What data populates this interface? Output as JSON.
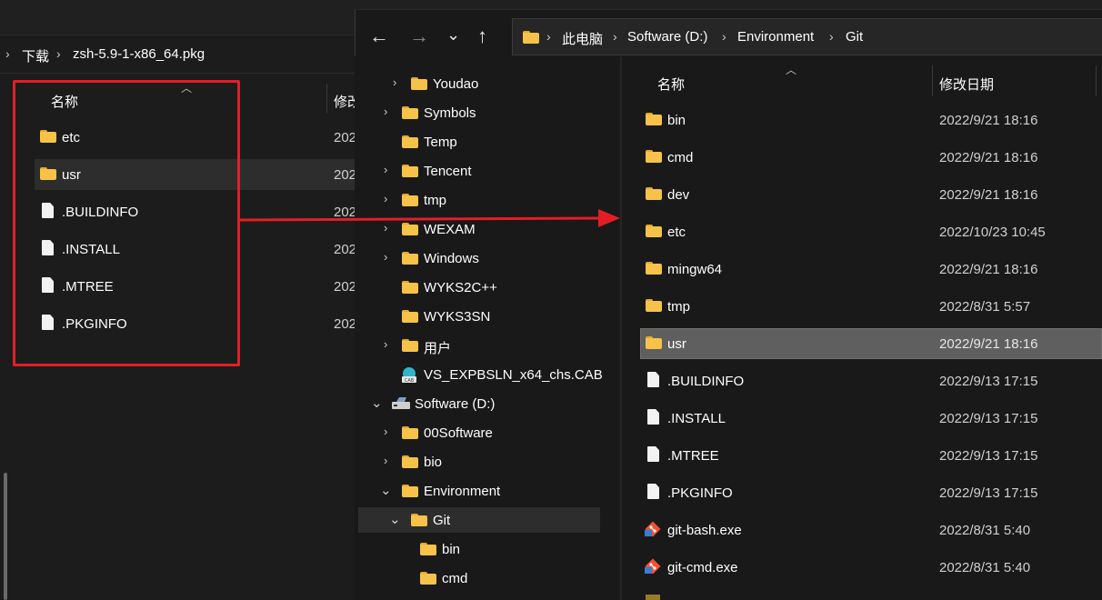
{
  "left_window": {
    "breadcrumb": [
      "下载",
      "zsh-5.9-1-x86_64.pkg"
    ],
    "columns": {
      "name": "名称",
      "modified_partial": "修改"
    },
    "items": [
      {
        "name": "etc",
        "type": "folder",
        "date_partial": "202"
      },
      {
        "name": "usr",
        "type": "folder",
        "date_partial": "202",
        "selected": true
      },
      {
        "name": ".BUILDINFO",
        "type": "file",
        "date_partial": "202"
      },
      {
        "name": ".INSTALL",
        "type": "file",
        "date_partial": "202"
      },
      {
        "name": ".MTREE",
        "type": "file",
        "date_partial": "202"
      },
      {
        "name": ".PKGINFO",
        "type": "file",
        "date_partial": "202"
      }
    ]
  },
  "right_window": {
    "breadcrumb": [
      "此电脑",
      "Software (D:)",
      "Environment",
      "Git"
    ],
    "nav_icons": [
      "back-arrow-icon",
      "forward-arrow-icon",
      "history-chevron-icon",
      "up-arrow-icon"
    ],
    "columns": {
      "name": "名称",
      "modified": "修改日期"
    },
    "nav_tree": [
      {
        "label": "Youdao",
        "type": "folder",
        "expandable": true
      },
      {
        "label": "Symbols",
        "type": "folder",
        "expandable": true
      },
      {
        "label": "Temp",
        "type": "folder",
        "expandable": false
      },
      {
        "label": "Tencent",
        "type": "folder",
        "expandable": true
      },
      {
        "label": "tmp",
        "type": "folder",
        "expandable": true
      },
      {
        "label": "WEXAM",
        "type": "folder",
        "expandable": true
      },
      {
        "label": "Windows",
        "type": "folder",
        "expandable": true
      },
      {
        "label": "WYKS2C++",
        "type": "folder",
        "expandable": false
      },
      {
        "label": "WYKS3SN",
        "type": "folder",
        "expandable": false
      },
      {
        "label": "用户",
        "type": "folder",
        "expandable": true
      },
      {
        "label": "VS_EXPBSLN_x64_chs.CAB",
        "type": "cab",
        "expandable": false
      },
      {
        "label": "Software (D:)",
        "type": "drive",
        "expanded": true
      },
      {
        "label": "00Software",
        "type": "folder",
        "expandable": true
      },
      {
        "label": "bio",
        "type": "folder",
        "expandable": true
      },
      {
        "label": "Environment",
        "type": "folder",
        "expanded": true
      },
      {
        "label": "Git",
        "type": "folder",
        "expanded": true,
        "selected": true
      },
      {
        "label": "bin",
        "type": "folder",
        "expandable": false
      },
      {
        "label": "cmd",
        "type": "folder",
        "expandable": false
      }
    ],
    "files": [
      {
        "name": "bin",
        "type": "folder",
        "date": "2022/9/21 18:16"
      },
      {
        "name": "cmd",
        "type": "folder",
        "date": "2022/9/21 18:16"
      },
      {
        "name": "dev",
        "type": "folder",
        "date": "2022/9/21 18:16"
      },
      {
        "name": "etc",
        "type": "folder",
        "date": "2022/10/23 10:45"
      },
      {
        "name": "mingw64",
        "type": "folder",
        "date": "2022/9/21 18:16"
      },
      {
        "name": "tmp",
        "type": "folder",
        "date": "2022/8/31 5:57"
      },
      {
        "name": "usr",
        "type": "folder",
        "date": "2022/9/21 18:16",
        "selected": true
      },
      {
        "name": ".BUILDINFO",
        "type": "file",
        "date": "2022/9/13 17:15"
      },
      {
        "name": ".INSTALL",
        "type": "file",
        "date": "2022/9/13 17:15"
      },
      {
        "name": ".MTREE",
        "type": "file",
        "date": "2022/9/13 17:15"
      },
      {
        "name": ".PKGINFO",
        "type": "file",
        "date": "2022/9/13 17:15"
      },
      {
        "name": "git-bash.exe",
        "type": "git",
        "date": "2022/8/31 5:40"
      },
      {
        "name": "git-cmd.exe",
        "type": "git",
        "date": "2022/8/31 5:40"
      }
    ]
  },
  "annotation": {
    "box_color": "#e41e26",
    "arrow_color": "#e41e26"
  }
}
